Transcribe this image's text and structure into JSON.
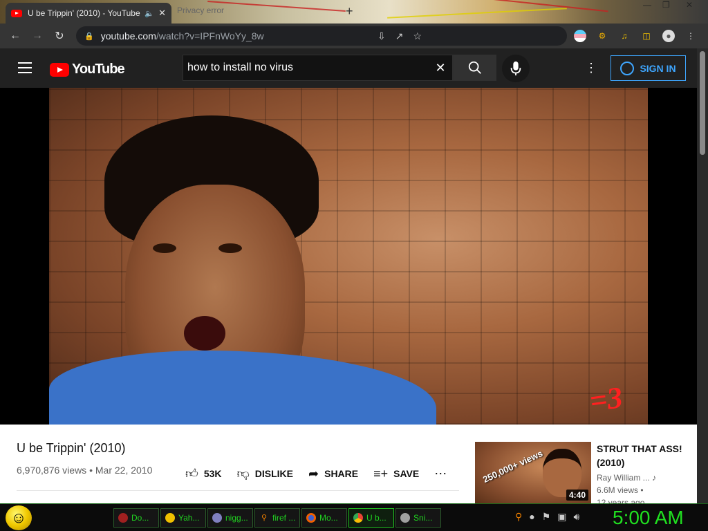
{
  "browser": {
    "active_tab": {
      "title": "U be Trippin' (2010) - YouTube"
    },
    "inactive_tab": {
      "title": "Privacy error"
    },
    "url": {
      "host": "youtube.com",
      "path": "/watch?v=IPFnWoYy_8w"
    }
  },
  "youtube": {
    "logo_text": "YouTube",
    "search_query": "how to install no virus",
    "sign_in_label": "SIGN IN"
  },
  "video": {
    "overlay_text": "=3",
    "title": "U be Trippin' (2010)",
    "views": "6,970,876 views",
    "date": "Mar 22, 2010",
    "like_count": "53K",
    "dislike_label": "DISLIKE",
    "share_label": "SHARE",
    "save_label": "SAVE"
  },
  "recommendation": {
    "title": "STRUT THAT ASS! (2010)",
    "channel": "Ray William ...",
    "views": "6.6M views •",
    "age": "12 years ago",
    "duration": "4:40",
    "thumb_badge": "250,000+ views"
  },
  "taskbar": {
    "items": [
      {
        "label": "Do...",
        "icon": "document-icon"
      },
      {
        "label": "Yah...",
        "icon": "smiley-icon"
      },
      {
        "label": "nigg...",
        "icon": "app-icon"
      },
      {
        "label": "firef ...",
        "icon": "search-icon"
      },
      {
        "label": "Mo...",
        "icon": "firefox-icon"
      },
      {
        "label": "U b...",
        "icon": "chrome-icon"
      },
      {
        "label": "Sni...",
        "icon": "snipping-icon"
      }
    ],
    "clock": "5:00 AM"
  }
}
